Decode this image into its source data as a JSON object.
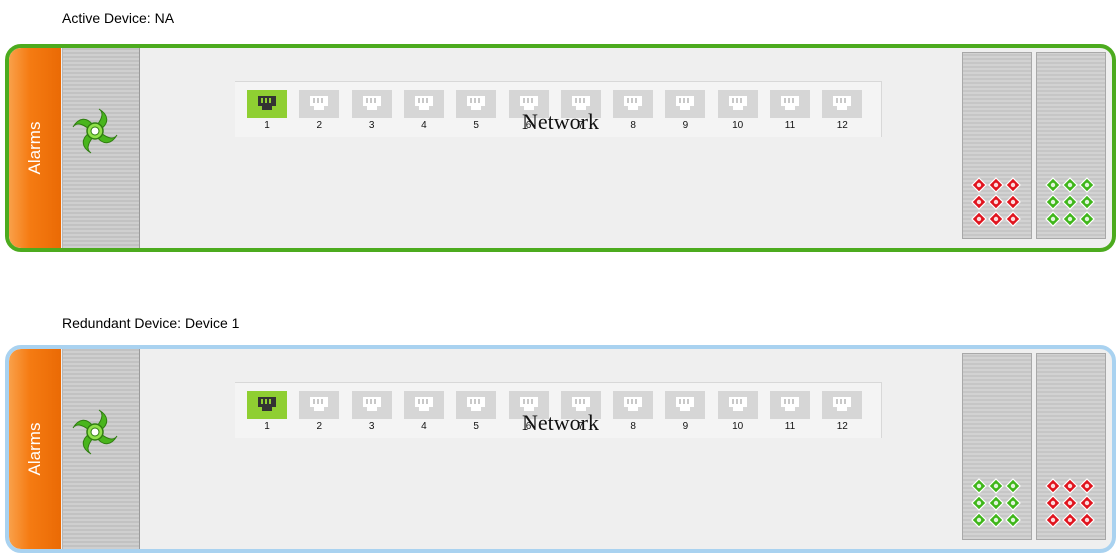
{
  "devices": [
    {
      "label": "Active Device: NA",
      "alarm_label": "Alarms",
      "network_label": "Network",
      "border": "active",
      "active_port": "1",
      "ports": [
        "1",
        "2",
        "3",
        "4",
        "5",
        "6",
        "7",
        "8",
        "9",
        "10",
        "11",
        "12"
      ],
      "psu_status": [
        "fault",
        "ok"
      ]
    },
    {
      "label": "Redundant Device: Device 1",
      "alarm_label": "Alarms",
      "network_label": "Network",
      "border": "redundant",
      "active_port": "1",
      "ports": [
        "1",
        "2",
        "3",
        "4",
        "5",
        "6",
        "7",
        "8",
        "9",
        "10",
        "11",
        "12"
      ],
      "psu_status": [
        "ok",
        "fault"
      ]
    }
  ],
  "colors": {
    "active_border": "#4cab1e",
    "redundant_border": "#a9d2f0",
    "alarm_tab": "#f57b12",
    "port_active": "#8fcf32",
    "port_inactive": "#d6d6d6",
    "led_ok": "#3fb61a",
    "led_fault": "#e0141e"
  },
  "icons": {
    "fan": "fan-icon",
    "port": "ethernet-port-icon",
    "led": "status-led-icon"
  }
}
